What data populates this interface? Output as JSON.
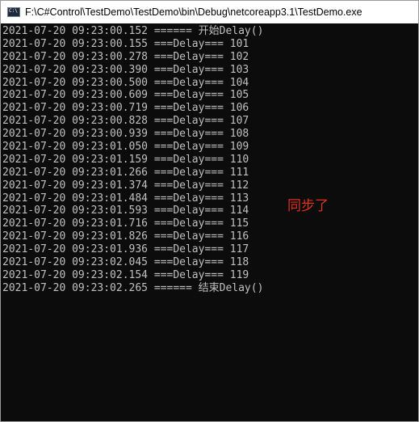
{
  "window": {
    "title": "F:\\C#Control\\TestDemo\\TestDemo\\bin\\Debug\\netcoreapp3.1\\TestDemo.exe",
    "icon": "console-app-icon",
    "icon_text": "C:\\"
  },
  "console": {
    "lines": [
      "2021-07-20 09:23:00.152 ====== 开始Delay()",
      "2021-07-20 09:23:00.155 ===Delay=== 101",
      "2021-07-20 09:23:00.278 ===Delay=== 102",
      "2021-07-20 09:23:00.390 ===Delay=== 103",
      "2021-07-20 09:23:00.500 ===Delay=== 104",
      "2021-07-20 09:23:00.609 ===Delay=== 105",
      "2021-07-20 09:23:00.719 ===Delay=== 106",
      "2021-07-20 09:23:00.828 ===Delay=== 107",
      "2021-07-20 09:23:00.939 ===Delay=== 108",
      "2021-07-20 09:23:01.050 ===Delay=== 109",
      "2021-07-20 09:23:01.159 ===Delay=== 110",
      "2021-07-20 09:23:01.266 ===Delay=== 111",
      "2021-07-20 09:23:01.374 ===Delay=== 112",
      "2021-07-20 09:23:01.484 ===Delay=== 113",
      "2021-07-20 09:23:01.593 ===Delay=== 114",
      "2021-07-20 09:23:01.716 ===Delay=== 115",
      "2021-07-20 09:23:01.826 ===Delay=== 116",
      "2021-07-20 09:23:01.936 ===Delay=== 117",
      "2021-07-20 09:23:02.045 ===Delay=== 118",
      "2021-07-20 09:23:02.154 ===Delay=== 119",
      "2021-07-20 09:23:02.265 ====== 结束Delay()"
    ]
  },
  "annotation": {
    "text": "同步了",
    "color": "#e0301e"
  },
  "colors": {
    "console_bg": "#0c0c0c",
    "console_text": "#c0c0c0",
    "titlebar_bg": "#ffffff"
  }
}
